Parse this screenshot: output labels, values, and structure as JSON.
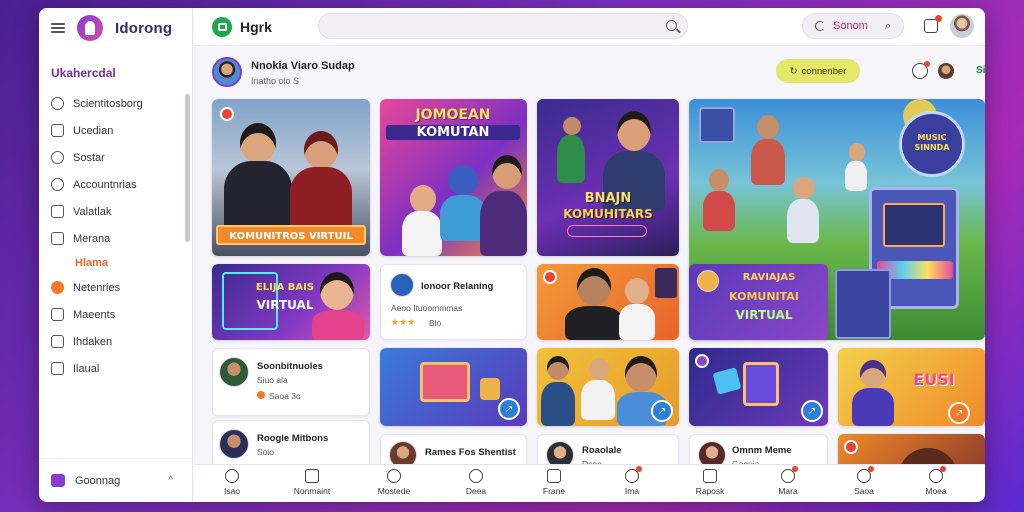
{
  "sidebar": {
    "brand": "Idorong",
    "section_title": "Ukahercdal",
    "items": [
      {
        "label": "Scientitosborg",
        "icon": "home-icon"
      },
      {
        "label": "Ucedian",
        "icon": "folder-icon"
      },
      {
        "label": "Sostar",
        "icon": "compass-icon"
      },
      {
        "label": "Accountnrias",
        "icon": "user-icon"
      },
      {
        "label": "Valatlak",
        "icon": "bookmark-icon"
      },
      {
        "label": "Merana",
        "icon": "chat-icon"
      }
    ],
    "highlight_label": "Hlama",
    "items2": [
      {
        "label": "Netenries",
        "icon": "star-icon"
      },
      {
        "label": "Maeents",
        "icon": "list-icon"
      },
      {
        "label": "Ihdaken",
        "icon": "calendar-icon"
      },
      {
        "label": "Ilaual",
        "icon": "settings-icon"
      }
    ],
    "bottom_label": "Goonnag"
  },
  "header": {
    "app_name": "Hgrk",
    "search_placeholder": "",
    "pill_search_label": "Sonom"
  },
  "profile": {
    "name": "Nnokia Viaro Sudap",
    "subtitle": "Inatho olo S",
    "follow_label": "connenber",
    "mini_label": "Siaia"
  },
  "cards": {
    "c1_banner": "KOMUNITROS VIRTUIL",
    "c2_banner_top": "JOMOEAN",
    "c2_banner_mid": "KOMUTAN",
    "c3_banner_top": "BNAJN",
    "c3_banner_mid": "KOMUHITARS",
    "c4_badge": "MUSIC SINNDA",
    "c5_banner_top": "ELIJA BAIS",
    "c5_banner_mid": "VIRTUAL",
    "c6_title": "Ionoor Relaning",
    "c6_sub": "Aeoo Ituoommmas",
    "c6_rating": "Blo",
    "c8_banner_top": "RAVIAJAS",
    "c8_banner_mid": "KOMUNITAI",
    "c8_banner_bot": "VIRTUAL",
    "c9_title": "Soonbitnuoles",
    "c9_sub": "Siuo ala",
    "c9_meta": "Saoa 3o",
    "c14_banner": "EUSI",
    "c15_title": "Roogle Mitbons",
    "c15_sub": "Soio",
    "c16_title": "Rames Fos Shentist",
    "c17_title": "Roaolale",
    "c17_sub": "Dcoo",
    "c18_title": "Omnm Meme",
    "c18_sub": "Gaouia"
  },
  "bottom_nav": [
    {
      "label": "Isao",
      "icon": "home-icon"
    },
    {
      "label": "Nonmaint",
      "icon": "box-icon"
    },
    {
      "label": "Mostede",
      "icon": "people-icon"
    },
    {
      "label": "Deea",
      "icon": "minus-circle-icon"
    },
    {
      "label": "Frane",
      "icon": "play-icon"
    },
    {
      "label": "Ima",
      "icon": "user-icon"
    },
    {
      "label": "Raposk",
      "icon": "card-icon"
    },
    {
      "label": "Mara",
      "icon": "chat-icon"
    },
    {
      "label": "Saoa",
      "icon": "group-icon"
    },
    {
      "label": "Moea",
      "icon": "person-icon"
    }
  ],
  "colors": {
    "accent": "#7a3fd0",
    "highlight": "#f0622d",
    "follow_bg": "#e3e86a",
    "badge": "#e8442e"
  }
}
